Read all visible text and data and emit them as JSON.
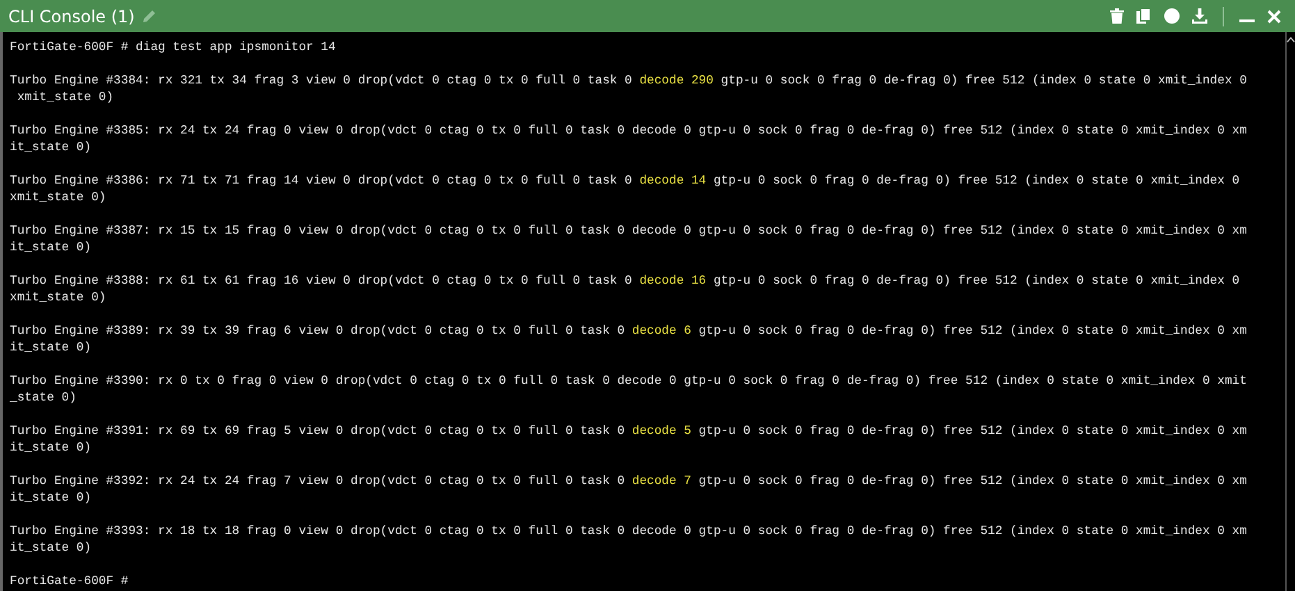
{
  "window": {
    "title": "CLI Console (1)"
  },
  "console": [
    {
      "lines": [
        [
          {
            "text": "FortiGate-600F # diag test app ipsmonitor 14",
            "highlight": false
          }
        ]
      ]
    },
    {
      "lines": [
        [
          {
            "text": "Turbo Engine #3384: rx 321 tx 34 frag 3 view 0 drop(vdct 0 ctag 0 tx 0 full 0 task 0 ",
            "highlight": false
          },
          {
            "text": "decode 290",
            "highlight": true
          },
          {
            "text": " gtp-u 0 sock 0 frag 0 de-frag 0) free 512 (index 0 state 0 xmit_index 0",
            "highlight": false
          }
        ],
        [
          {
            "text": " xmit_state 0)",
            "highlight": false
          }
        ]
      ]
    },
    {
      "lines": [
        [
          {
            "text": "Turbo Engine #3385: rx 24 tx 24 frag 0 view 0 drop(vdct 0 ctag 0 tx 0 full 0 task 0 decode 0 gtp-u 0 sock 0 frag 0 de-frag 0) free 512 (index 0 state 0 xmit_index 0 xm",
            "highlight": false
          }
        ],
        [
          {
            "text": "it_state 0)",
            "highlight": false
          }
        ]
      ]
    },
    {
      "lines": [
        [
          {
            "text": "Turbo Engine #3386: rx 71 tx 71 frag 14 view 0 drop(vdct 0 ctag 0 tx 0 full 0 task 0 ",
            "highlight": false
          },
          {
            "text": "decode 14",
            "highlight": true
          },
          {
            "text": " gtp-u 0 sock 0 frag 0 de-frag 0) free 512 (index 0 state 0 xmit_index 0",
            "highlight": false
          }
        ],
        [
          {
            "text": "xmit_state 0)",
            "highlight": false
          }
        ]
      ]
    },
    {
      "lines": [
        [
          {
            "text": "Turbo Engine #3387: rx 15 tx 15 frag 0 view 0 drop(vdct 0 ctag 0 tx 0 full 0 task 0 decode 0 gtp-u 0 sock 0 frag 0 de-frag 0) free 512 (index 0 state 0 xmit_index 0 xm",
            "highlight": false
          }
        ],
        [
          {
            "text": "it_state 0)",
            "highlight": false
          }
        ]
      ]
    },
    {
      "lines": [
        [
          {
            "text": "Turbo Engine #3388: rx 61 tx 61 frag 16 view 0 drop(vdct 0 ctag 0 tx 0 full 0 task 0 ",
            "highlight": false
          },
          {
            "text": "decode 16",
            "highlight": true
          },
          {
            "text": " gtp-u 0 sock 0 frag 0 de-frag 0) free 512 (index 0 state 0 xmit_index 0",
            "highlight": false
          }
        ],
        [
          {
            "text": "xmit_state 0)",
            "highlight": false
          }
        ]
      ]
    },
    {
      "lines": [
        [
          {
            "text": "Turbo Engine #3389: rx 39 tx 39 frag 6 view 0 drop(vdct 0 ctag 0 tx 0 full 0 task 0 ",
            "highlight": false
          },
          {
            "text": "decode 6",
            "highlight": true
          },
          {
            "text": " gtp-u 0 sock 0 frag 0 de-frag 0) free 512 (index 0 state 0 xmit_index 0 xm",
            "highlight": false
          }
        ],
        [
          {
            "text": "it_state 0)",
            "highlight": false
          }
        ]
      ]
    },
    {
      "lines": [
        [
          {
            "text": "Turbo Engine #3390: rx 0 tx 0 frag 0 view 0 drop(vdct 0 ctag 0 tx 0 full 0 task 0 decode 0 gtp-u 0 sock 0 frag 0 de-frag 0) free 512 (index 0 state 0 xmit_index 0 xmit",
            "highlight": false
          }
        ],
        [
          {
            "text": "_state 0)",
            "highlight": false
          }
        ]
      ]
    },
    {
      "lines": [
        [
          {
            "text": "Turbo Engine #3391: rx 69 tx 69 frag 5 view 0 drop(vdct 0 ctag 0 tx 0 full 0 task 0 ",
            "highlight": false
          },
          {
            "text": "decode 5",
            "highlight": true
          },
          {
            "text": " gtp-u 0 sock 0 frag 0 de-frag 0) free 512 (index 0 state 0 xmit_index 0 xm",
            "highlight": false
          }
        ],
        [
          {
            "text": "it_state 0)",
            "highlight": false
          }
        ]
      ]
    },
    {
      "lines": [
        [
          {
            "text": "Turbo Engine #3392: rx 24 tx 24 frag 7 view 0 drop(vdct 0 ctag 0 tx 0 full 0 task 0 ",
            "highlight": false
          },
          {
            "text": "decode 7",
            "highlight": true
          },
          {
            "text": " gtp-u 0 sock 0 frag 0 de-frag 0) free 512 (index 0 state 0 xmit_index 0 xm",
            "highlight": false
          }
        ],
        [
          {
            "text": "it_state 0)",
            "highlight": false
          }
        ]
      ]
    },
    {
      "lines": [
        [
          {
            "text": "Turbo Engine #3393: rx 18 tx 18 frag 0 view 0 drop(vdct 0 ctag 0 tx 0 full 0 task 0 decode 0 gtp-u 0 sock 0 frag 0 de-frag 0) free 512 (index 0 state 0 xmit_index 0 xm",
            "highlight": false
          }
        ],
        [
          {
            "text": "it_state 0)",
            "highlight": false
          }
        ]
      ]
    },
    {
      "lines": [
        [
          {
            "text": "FortiGate-600F #",
            "highlight": false
          }
        ]
      ]
    }
  ]
}
